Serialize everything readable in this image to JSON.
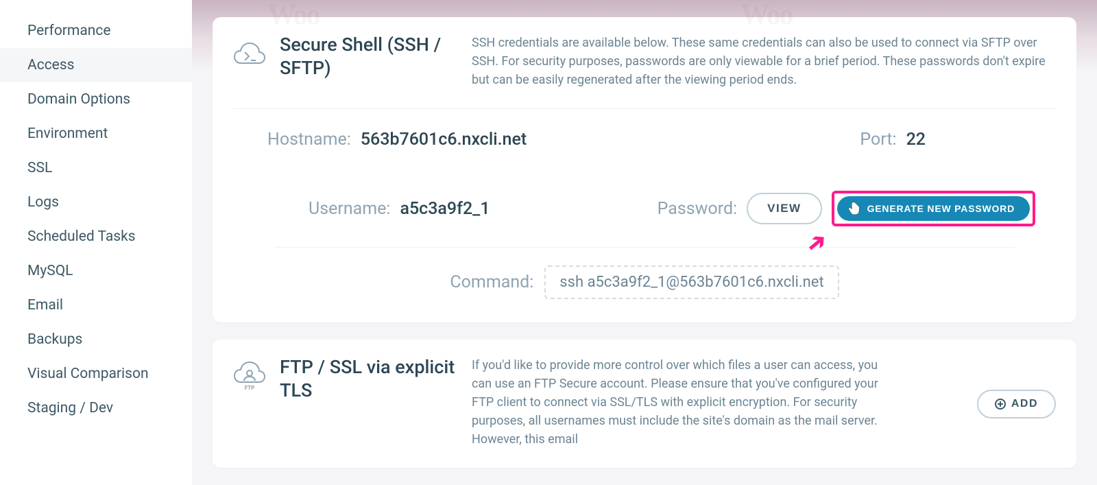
{
  "sidebar": {
    "items": [
      {
        "label": "Performance"
      },
      {
        "label": "Access"
      },
      {
        "label": "Domain Options"
      },
      {
        "label": "Environment"
      },
      {
        "label": "SSL"
      },
      {
        "label": "Logs"
      },
      {
        "label": "Scheduled Tasks"
      },
      {
        "label": "MySQL"
      },
      {
        "label": "Email"
      },
      {
        "label": "Backups"
      },
      {
        "label": "Visual Comparison"
      },
      {
        "label": "Staging / Dev"
      }
    ],
    "active_index": 1
  },
  "ssh_card": {
    "title": "Secure Shell (SSH / SFTP)",
    "description": "SSH credentials are available below. These same credentials can also be used to connect via SFTP over SSH. For security purposes, passwords are only viewable for a brief period. These passwords don't expire but can be easily regenerated after the viewing period ends.",
    "hostname_label": "Hostname:",
    "hostname_value": "563b7601c6.nxcli.net",
    "port_label": "Port:",
    "port_value": "22",
    "username_label": "Username:",
    "username_value": "a5c3a9f2_1",
    "password_label": "Password:",
    "view_button": "VIEW",
    "generate_button": "GENERATE NEW PASSWORD",
    "command_label": "Command:",
    "command_value": "ssh a5c3a9f2_1@563b7601c6.nxcli.net"
  },
  "ftp_card": {
    "title": "FTP / SSL via explicit TLS",
    "description": "If you'd like to provide more control over which files a user can access, you can use an FTP Secure account. Please ensure that you've configured your FTP client to connect via SSL/TLS with explicit encryption. For security purposes, all usernames must include the site's domain as the mail server. However, this email",
    "add_button": "ADD"
  },
  "bg": {
    "woo": "Woo"
  }
}
